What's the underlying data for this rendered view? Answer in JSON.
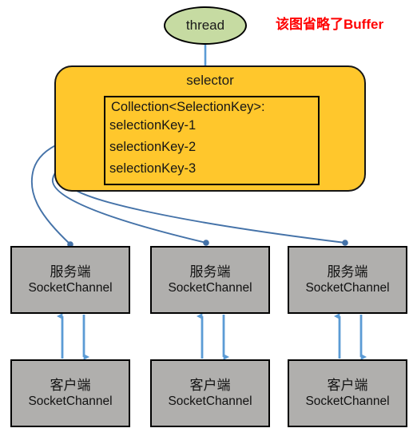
{
  "diagram": {
    "title_note": "该图省略了Buffer",
    "thread": {
      "label": "thread"
    },
    "selector": {
      "label": "selector",
      "collection": {
        "header": "Collection<SelectionKey>:",
        "keys": [
          {
            "label": "selectionKey-1"
          },
          {
            "label": "selectionKey-2"
          },
          {
            "label": "selectionKey-3"
          }
        ]
      }
    },
    "servers": [
      {
        "line1": "服务端",
        "line2": "SocketChannel"
      },
      {
        "line1": "服务端",
        "line2": "SocketChannel"
      },
      {
        "line1": "服务端",
        "line2": "SocketChannel"
      }
    ],
    "clients": [
      {
        "line1": "客户端",
        "line2": "SocketChannel"
      },
      {
        "line1": "客户端",
        "line2": "SocketChannel"
      },
      {
        "line1": "客户端",
        "line2": "SocketChannel"
      }
    ],
    "colors": {
      "selector_fill": "#ffc72c",
      "thread_fill": "#c6dba2",
      "node_fill": "#b0afad",
      "connector": "#4472a8",
      "arrow": "#5b9bd5",
      "note": "#ff0000",
      "stroke": "#000000"
    }
  }
}
